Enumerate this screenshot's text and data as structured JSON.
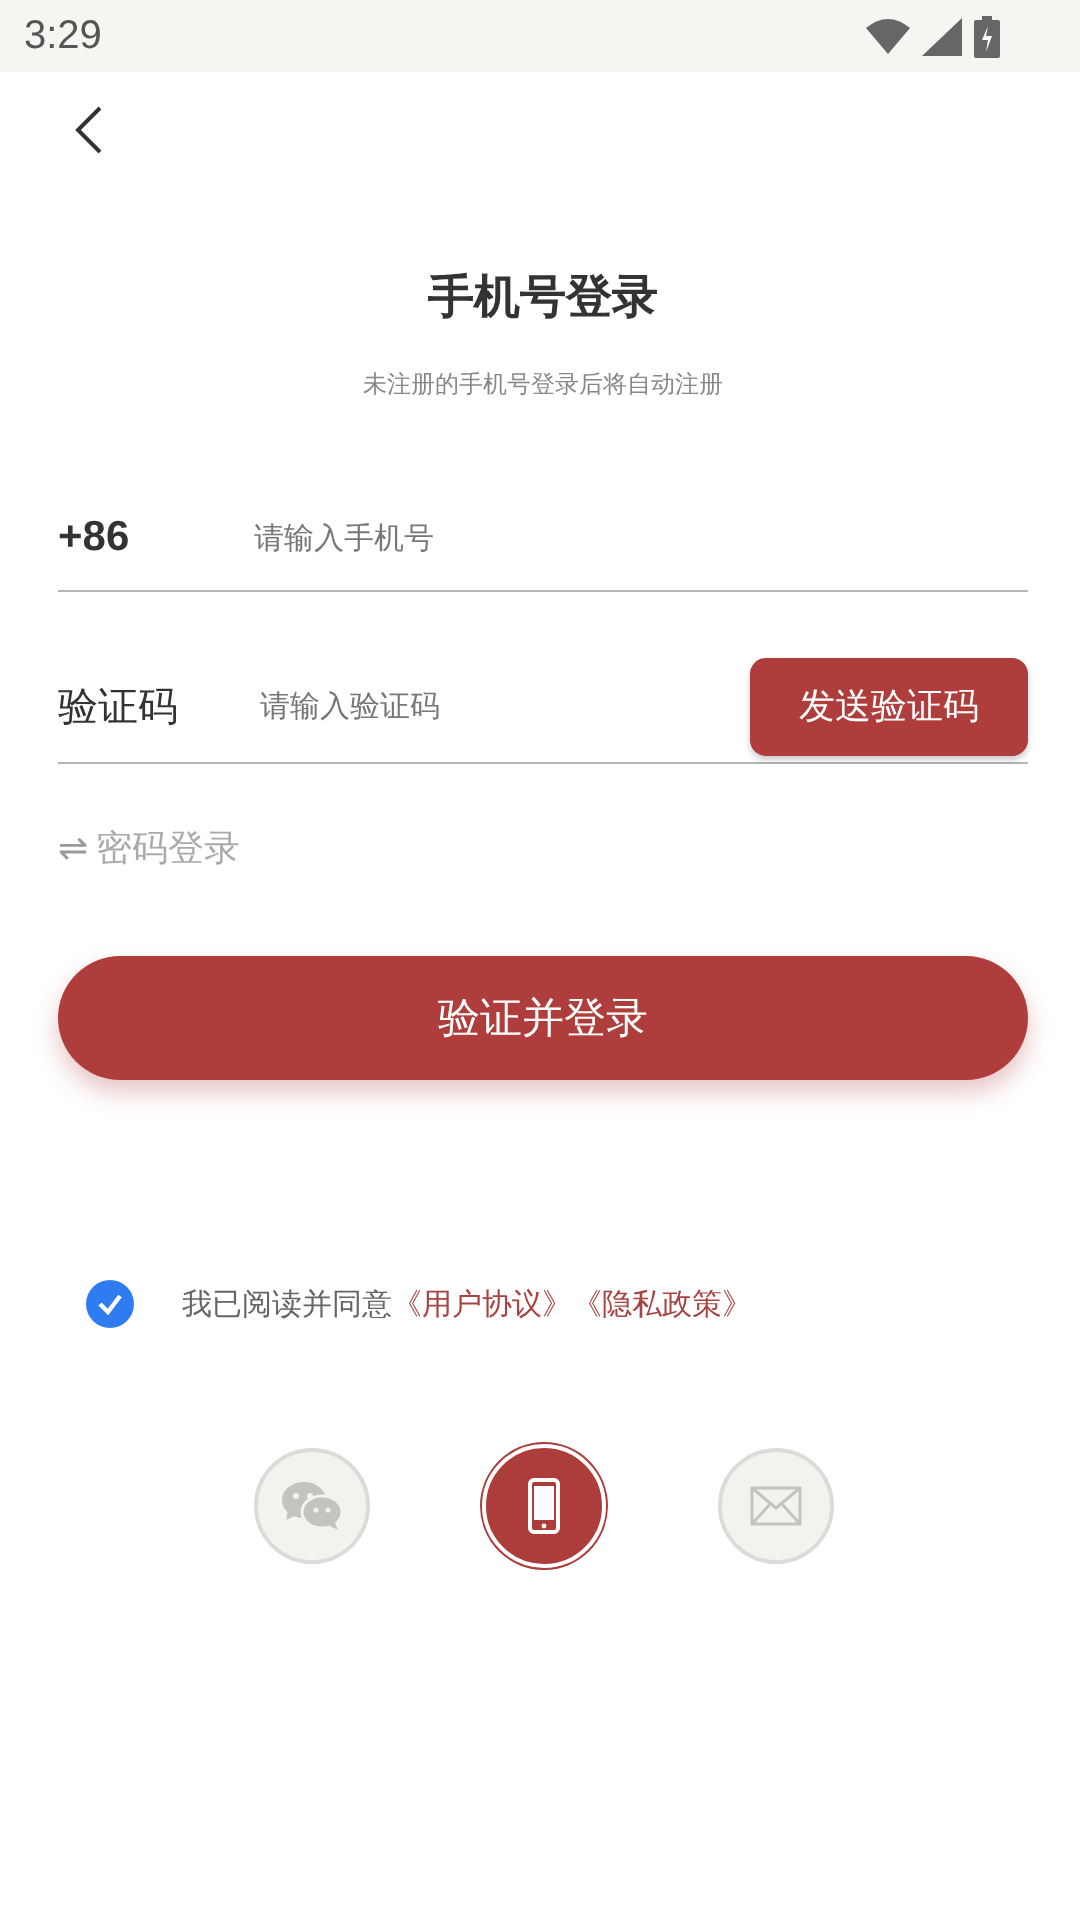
{
  "status_bar": {
    "time": "3:29"
  },
  "title": "手机号登录",
  "subtitle": "未注册的手机号登录后将自动注册",
  "phone_field": {
    "prefix": "+86",
    "placeholder": "请输入手机号"
  },
  "code_field": {
    "label": "验证码",
    "placeholder": "请输入验证码",
    "button": "发送验证码"
  },
  "switch_link": {
    "icon": "⇌",
    "label": "密码登录"
  },
  "submit_button": "验证并登录",
  "agreement": {
    "checked": true,
    "text": "我已阅读并同意",
    "links": [
      "《用户协议》",
      "《隐私政策》"
    ]
  },
  "login_methods": [
    {
      "kind": "wechat",
      "selected": false
    },
    {
      "kind": "phone",
      "selected": true
    },
    {
      "kind": "mail",
      "selected": false
    }
  ]
}
